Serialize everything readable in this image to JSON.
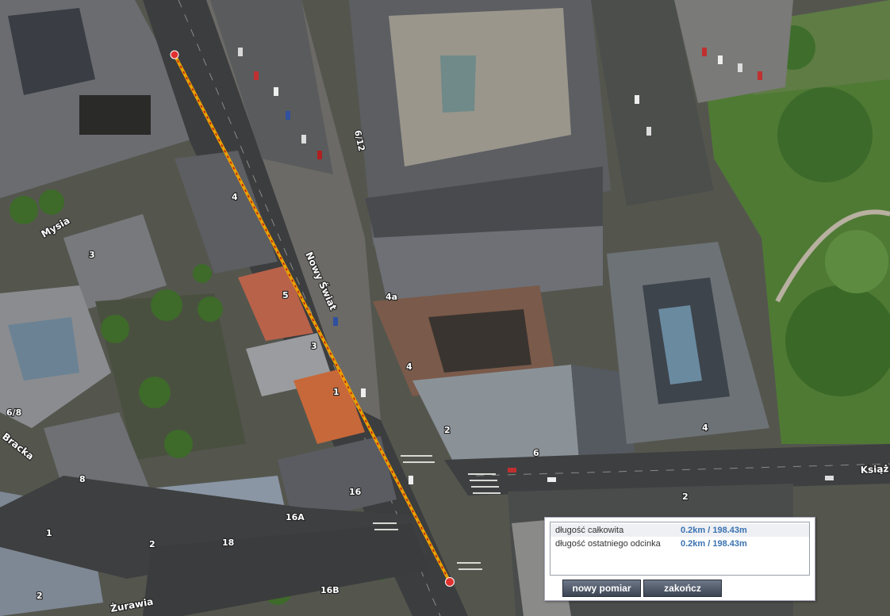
{
  "map": {
    "streets": {
      "nowy_swiat": "Nowy Świat",
      "mysia": "Mysia",
      "bracka": "Bracka",
      "zurawia": "Żurawia",
      "ksiaze": "Książ"
    },
    "house_numbers": [
      "6/12",
      "4",
      "4a",
      "4",
      "2",
      "6",
      "5",
      "3",
      "1",
      "2",
      "16",
      "16A",
      "18",
      "16B",
      "2",
      "4",
      "8",
      "3",
      "1",
      "2",
      "6/8"
    ]
  },
  "measure_panel": {
    "rows": [
      {
        "label": "długość całkowita",
        "value": "0.2km / 198.43m"
      },
      {
        "label": "długość ostatniego odcinka",
        "value": "0.2km / 198.43m"
      }
    ],
    "new_button": "nowy pomiar",
    "end_button": "zakończ"
  },
  "colors": {
    "measure_line": "#e8a000",
    "measure_line_dash": "#c0101a",
    "endpoint": "#e03030"
  }
}
